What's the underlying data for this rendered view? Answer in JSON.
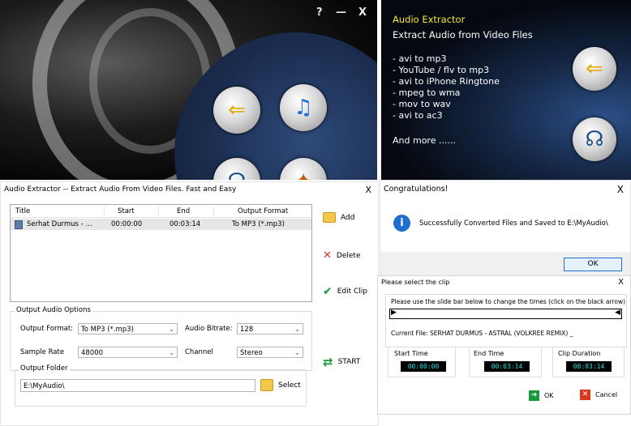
{
  "main_window": {
    "title_buttons": [
      "?",
      "—",
      "X"
    ]
  },
  "info_panel": {
    "title": "Audio Extractor",
    "subtitle": "Extract Audio from Video Files",
    "features": [
      "-  avi to mp3",
      "-  YouTube / flv to mp3",
      "-  avi to iPhone Ringtone",
      "-  mpeg to wma",
      "-  mov to wav",
      "-  avi to ac3"
    ],
    "more": "And more  ......"
  },
  "extractor_dialog": {
    "title": "Audio Extractor -- Extract Audio From Video Files.  Fast and Easy",
    "close": "X",
    "columns": [
      "Title",
      "Start",
      "End",
      "Output Format"
    ],
    "rows": [
      {
        "title": "Serhat Durmus - ...",
        "start": "00:00:00",
        "end": "00:03:14",
        "format": "To MP3    (*.mp3)"
      }
    ],
    "buttons": {
      "add": "Add",
      "delete": "Delete",
      "edit_clip": "Edit Clip",
      "start": "START",
      "select": "Select"
    },
    "options": {
      "group_label": "Output Audio Options",
      "output_format_label": "Output Format:",
      "output_format_value": "To MP3    (*.mp3)",
      "audio_bitrate_label": "Audio Bitrate:",
      "audio_bitrate_value": "128",
      "sample_rate_label": "Sample Rate",
      "sample_rate_value": "48000",
      "channel_label": "Channel",
      "channel_value": "Stereo",
      "output_folder_label": "Output Folder",
      "output_folder_value": "E:\\MyAudio\\"
    }
  },
  "congrats_dialog": {
    "title": "Congratulations!",
    "close": "X",
    "message": "Successfully Converted Files and Saved to E:\\MyAudio\\",
    "ok": "OK"
  },
  "clip_dialog": {
    "title": "Please select the clip",
    "close": "X",
    "instruction": "Please use the slide bar below to change the times  (click on the black arrow)",
    "current_file": "Current File: SERHAT DURMUS - ASTRAL (VOLKREE REMIX) _",
    "start_label": "Start Time",
    "start_value": "00:00:00",
    "end_label": "End Time",
    "end_value": "00:03:14",
    "duration_label": "Clip Duration",
    "duration_value": "00:03:14",
    "ok": "OK",
    "cancel": "Cancel"
  },
  "colors": {
    "accent_yellow": "#f5e642",
    "ok_green": "#1a9a3a",
    "cancel_red": "#d83a1e",
    "lcd_text": "#22e0e0"
  }
}
